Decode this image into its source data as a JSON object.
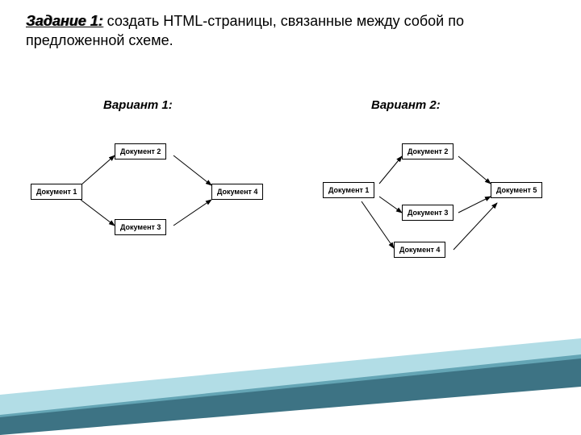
{
  "heading": {
    "task_label": "Задание 1:",
    "task_text": "  создать HTML-страницы, связанные между собой по предложенной схеме."
  },
  "variant1": {
    "label": "Вариант 1:",
    "doc1": "Документ 1",
    "doc2": "Документ 2",
    "doc3": "Документ 3",
    "doc4": "Документ 4"
  },
  "variant2": {
    "label": "Вариант 2:",
    "doc1": "Документ 1",
    "doc2": "Документ 2",
    "doc3": "Документ 3",
    "doc4": "Документ 4",
    "doc5": "Документ 5"
  }
}
